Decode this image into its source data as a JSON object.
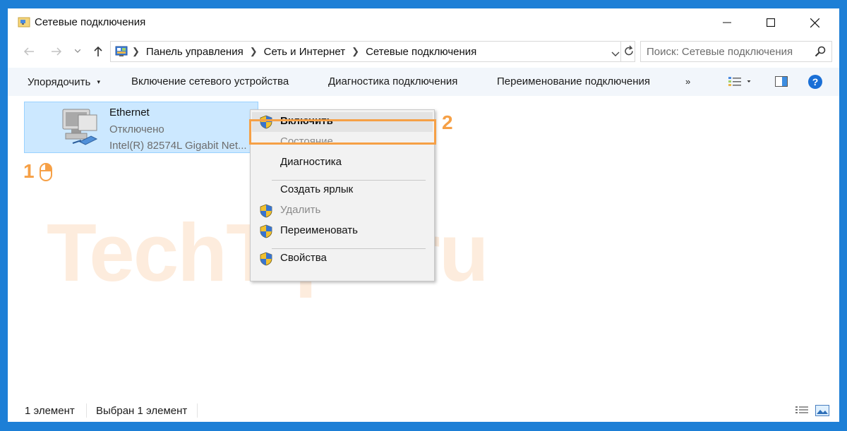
{
  "window": {
    "title": "Сетевые подключения"
  },
  "address": {
    "crumbs": [
      "Панель управления",
      "Сеть и Интернет",
      "Сетевые подключения"
    ]
  },
  "search": {
    "placeholder": "Поиск: Сетевые подключения"
  },
  "toolbar": {
    "organize": "Упорядочить",
    "enable_device": "Включение сетевого устройства",
    "diagnose": "Диагностика подключения",
    "rename": "Переименование подключения",
    "more": "»"
  },
  "item": {
    "name": "Ethernet",
    "status": "Отключено",
    "device": "Intel(R) 82574L Gigabit Net..."
  },
  "context_menu": {
    "items": [
      {
        "label": "Включить",
        "shield": true,
        "bold": true,
        "disabled": false
      },
      {
        "label": "Состояние",
        "shield": false,
        "disabled": true
      },
      {
        "label": "Диагностика",
        "shield": false,
        "disabled": false
      },
      {
        "label": "Создать ярлык",
        "shield": false,
        "disabled": false
      },
      {
        "label": "Удалить",
        "shield": true,
        "disabled": true
      },
      {
        "label": "Переименовать",
        "shield": true,
        "disabled": false
      },
      {
        "label": "Свойства",
        "shield": true,
        "disabled": false
      }
    ]
  },
  "annotations": {
    "step1": "1",
    "step2": "2"
  },
  "watermark": "TechTips.ru",
  "statusbar": {
    "count": "1 элемент",
    "selected": "Выбран 1 элемент"
  },
  "colors": {
    "accent": "#f6a046",
    "selection": "#cce8ff",
    "desktop": "#1d7fd6"
  }
}
